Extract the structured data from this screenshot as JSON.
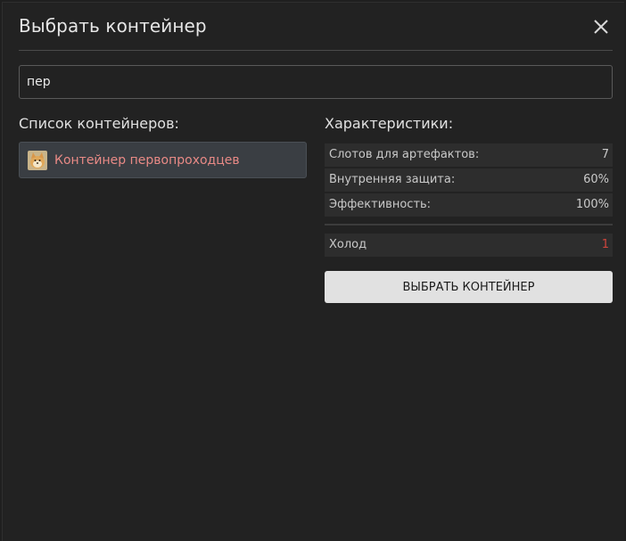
{
  "modal": {
    "title": "Выбрать контейнер",
    "close_icon": "close-icon"
  },
  "search": {
    "value": "пер"
  },
  "container_list": {
    "heading": "Список контейнеров:",
    "items": [
      {
        "label": "Контейнер первопроходцев",
        "icon": "doge-avatar-icon",
        "color": "#e98a86"
      }
    ]
  },
  "stats": {
    "heading": "Характеристики:",
    "rows": [
      {
        "key": "Слотов для артефактов:",
        "value": "7"
      },
      {
        "key": "Внутренняя защита:",
        "value": "60%"
      },
      {
        "key": "Эффективность:",
        "value": "100%"
      }
    ],
    "extra_rows": [
      {
        "key": "Холод",
        "value": "1",
        "color": "#d0453c"
      }
    ]
  },
  "select_button": {
    "label": "ВЫБРАТЬ КОНТЕЙНЕР"
  }
}
